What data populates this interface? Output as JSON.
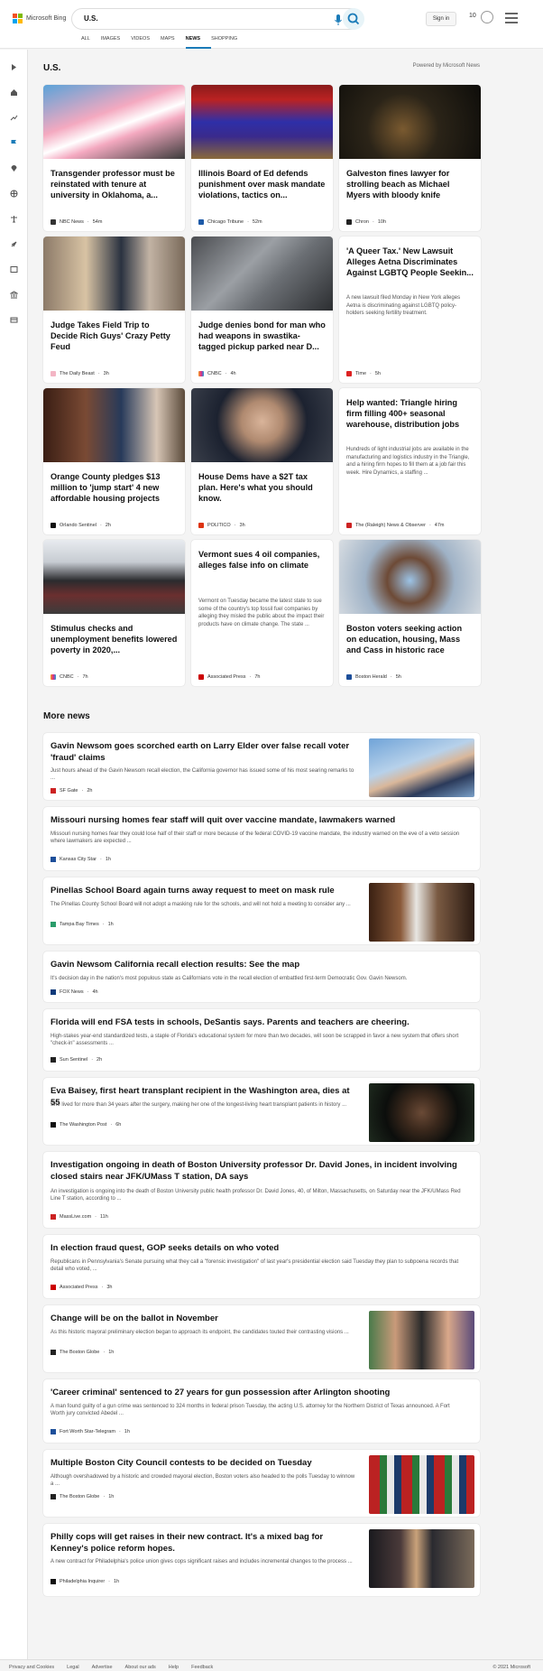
{
  "header": {
    "brand": "Microsoft Bing",
    "query": "U.S.",
    "sign_in": "Sign in",
    "rewards": "10",
    "colors": [
      "#f25022",
      "#7fba00",
      "#00a4ef",
      "#ffb900"
    ]
  },
  "tabs": [
    "ALL",
    "IMAGES",
    "VIDEOS",
    "MAPS",
    "NEWS",
    "SHOPPING"
  ],
  "active_tab": "NEWS",
  "section": {
    "title": "U.S.",
    "powered": "Powered by Microsoft News"
  },
  "cards": [
    {
      "title": "Transgender professor must be reinstated with tenure at university in Oklahoma, a...",
      "source": "NBC News",
      "time": "54m"
    },
    {
      "title": "Illinois Board of Ed defends punishment over mask mandate violations, tactics on...",
      "source": "Chicago Tribune",
      "time": "52m"
    },
    {
      "title": "Galveston fines lawyer for strolling beach as Michael Myers with bloody knife",
      "source": "Chron",
      "time": "10h"
    },
    {
      "title": "Judge Takes Field Trip to Decide Rich Guys' Crazy Petty Feud",
      "source": "The Daily Beast",
      "time": "3h"
    },
    {
      "title": "Judge denies bond for man who had weapons in swastika-tagged pickup parked near D...",
      "source": "CNBC",
      "time": "4h"
    },
    {
      "title": "'A Queer Tax.' New Lawsuit Alleges Aetna Discriminates Against LGBTQ People Seekin...",
      "desc": "A new lawsuit filed Monday in New York alleges Aetna is discriminating against LGBTQ policy-holders seeking fertility treatment.",
      "source": "Time",
      "time": "5h"
    },
    {
      "title": "Orange County pledges $13 million to 'jump start' 4 new affordable housing projects",
      "source": "Orlando Sentinel",
      "time": "2h"
    },
    {
      "title": "House Dems have a $2T tax plan. Here's what you should know.",
      "source": "POLITICO",
      "time": "3h"
    },
    {
      "title": "Help wanted: Triangle hiring firm filling 400+ seasonal warehouse, distribution jobs",
      "desc": "Hundreds of light industrial jobs are available in the manufacturing and logistics industry in the Triangle, and a hiring firm hopes to fill them at a job fair this week. Hire Dynamics, a staffing ...",
      "source": "The (Raleigh) News & Observer",
      "time": "47m"
    },
    {
      "title": "Stimulus checks and unemployment benefits lowered poverty in 2020,...",
      "source": "CNBC",
      "time": "7h"
    },
    {
      "title": "Vermont sues 4 oil companies, alleges false info on climate",
      "desc": "Vermont on Tuesday became the latest state to sue some of the country's top fossil fuel companies by alleging they misled the public about the impact their products have on climate change. The state ...",
      "source": "Associated Press",
      "time": "7h"
    },
    {
      "title": "Boston voters seeking action on education, housing, Mass and Cass in historic race",
      "source": "Boston Herald",
      "time": "5h"
    }
  ],
  "more_title": "More news",
  "more": [
    {
      "title": "Gavin Newsom goes scorched earth on Larry Elder over false recall voter 'fraud' claims",
      "desc": "Just hours ahead of the Gavin Newsom recall election, the California governor has issued some of his most searing remarks to ...",
      "source": "SF Gate",
      "time": "2h"
    },
    {
      "title": "Missouri nursing homes fear staff will quit over vaccine mandate, lawmakers warned",
      "desc": "Missouri nursing homes fear they could lose half of their staff or more because of the federal COVID-19 vaccine mandate, the industry warned on the eve of a veto session where lawmakers are expected ...",
      "source": "Kansas City Star",
      "time": "1h"
    },
    {
      "title": "Pinellas School Board again turns away request to meet on mask rule",
      "desc": "The Pinellas County School Board will not adopt a masking rule for the schools, and will not hold a meeting to consider any ...",
      "source": "Tampa Bay Times",
      "time": "1h"
    },
    {
      "title": "Gavin Newsom California recall election results: See the map",
      "desc": "It's decision day in the nation's most populous state as Californians vote in the recall election of embattled first-term Democratic Gov. Gavin Newsom.",
      "source": "FOX News",
      "time": "4h"
    },
    {
      "title": "Florida will end FSA tests in schools, DeSantis says. Parents and teachers are cheering.",
      "desc": "High-stakes year-end standardized tests, a staple of Florida's educational system for more than two decades, will soon be scrapped in favor a new system that offers short \"check-in\" assessments ...",
      "source": "Sun Sentinel",
      "time": "2h"
    },
    {
      "title": "Eva Baisey, first heart transplant recipient in the Washington area, dies at 55",
      "desc": "She lived for more than 34 years after the surgery, making her one of the longest-living heart transplant patients in history ...",
      "source": "The Washington Post",
      "time": "6h"
    },
    {
      "title": "Investigation ongoing in death of Boston University professor Dr. David Jones, in incident involving closed stairs near JFK/UMass T station, DA says",
      "desc": "An investigation is ongoing into the death of Boston University public health professor Dr. David Jones, 40, of Milton, Massachusetts, on Saturday near the JFK/UMass Red Line T station, according to ...",
      "source": "MassLive.com",
      "time": "11h"
    },
    {
      "title": "In election fraud quest, GOP seeks details on who voted",
      "desc": "Republicans in Pennsylvania's Senate pursuing what they call a \"forensic investigation\" of last year's presidential election said Tuesday they plan to subpoena records that detail who voted, ...",
      "source": "Associated Press",
      "time": "3h"
    },
    {
      "title": "Change will be on the ballot in November",
      "desc": "As this historic mayoral preliminary election began to approach its endpoint, the candidates touted their contrasting visions ...",
      "source": "The Boston Globe",
      "time": "1h"
    },
    {
      "title": "'Career criminal' sentenced to 27 years for gun possession after Arlington shooting",
      "desc": "A man found guilty of a gun crime was sentenced to 324 months in federal prison Tuesday, the acting U.S. attorney for the Northern District of Texas announced. A Fort Worth jury convicted Abedel ...",
      "source": "Fort Worth Star-Telegram",
      "time": "1h"
    },
    {
      "title": "Multiple Boston City Council contests to be decided on Tuesday",
      "desc": "Although overshadowed by a historic and crowded mayoral election, Boston voters also headed to the polls Tuesday to winnow a ...",
      "source": "The Boston Globe",
      "time": "1h"
    },
    {
      "title": "Philly cops will get raises in their new contract. It's a mixed bag for Kenney's police reform hopes.",
      "desc": "A new contract for Philadelphia's police union gives cops significant raises and includes incremental changes to the process ...",
      "source": "Philadelphia Inquirer",
      "time": "1h"
    }
  ],
  "footer": {
    "links": [
      "Privacy and Cookies",
      "Legal",
      "Advertise",
      "About our ads",
      "Help",
      "Feedback"
    ],
    "copyright": "© 2021 Microsoft"
  }
}
